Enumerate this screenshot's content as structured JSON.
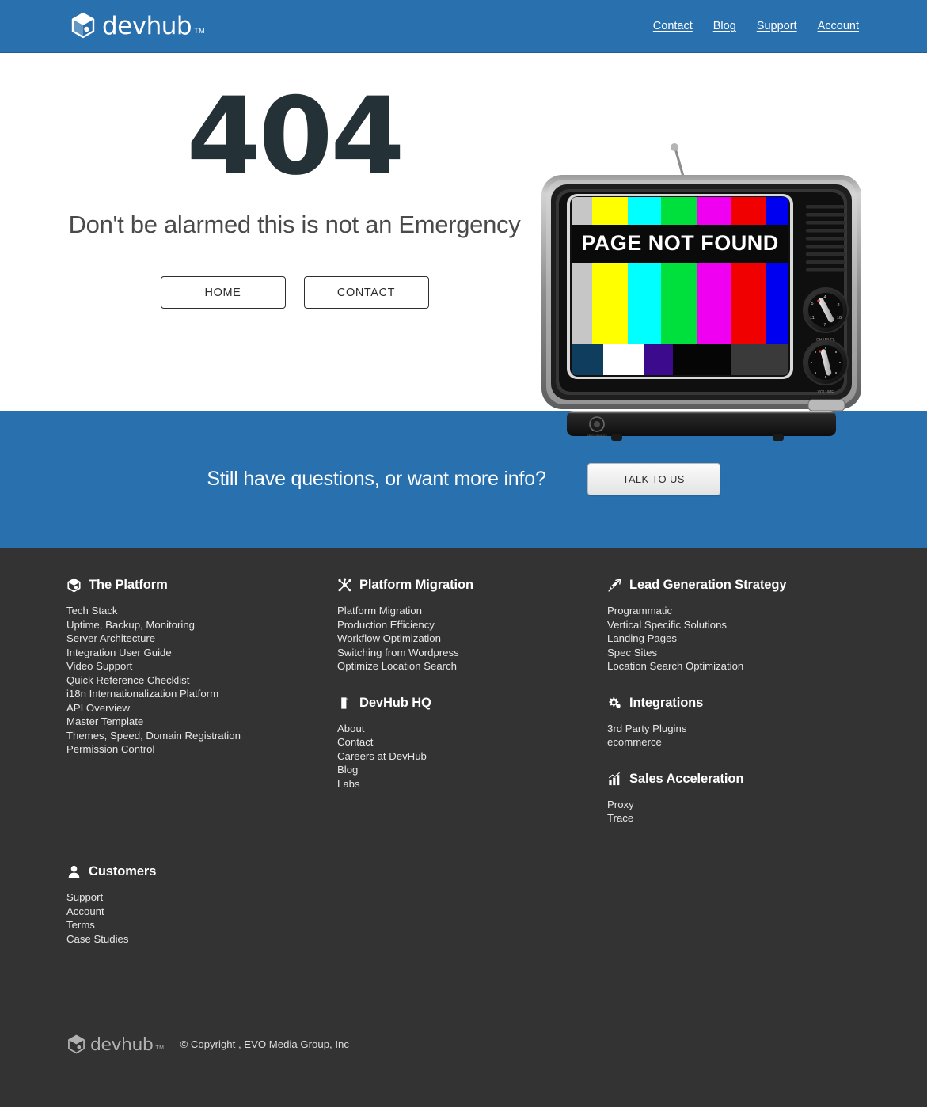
{
  "brand": {
    "name": "devhub",
    "tm": "TM",
    "header_bg": "#2870ae",
    "footer_bg": "#333333",
    "heading_color": "#243238"
  },
  "header": {
    "nav": [
      {
        "label": "Contact"
      },
      {
        "label": "Blog"
      },
      {
        "label": "Support"
      },
      {
        "label": "Account"
      }
    ]
  },
  "hero": {
    "code": "404",
    "subtitle": "Don't be alarmed this is not an Emergency",
    "buttons": [
      {
        "label": "HOME"
      },
      {
        "label": "CONTACT"
      }
    ],
    "tv": {
      "screen_message": "PAGE NOT FOUND",
      "knob_labels": [
        "CHANNEL",
        "VOLUME",
        "POWER"
      ],
      "base_label": "BRIGHTNESS",
      "color_bars": [
        "#c6c6c6",
        "#ffff00",
        "#00ffff",
        "#00e03c",
        "#f000f0",
        "#f00000",
        "#0000f0"
      ],
      "bottom_bars": [
        "#0e3d5e",
        "#ffffff",
        "#3c0a8c",
        "#050505",
        "#3a3a3a"
      ]
    }
  },
  "cta": {
    "text": "Still have questions, or want more info?",
    "button_label": "TALK TO US"
  },
  "footer": {
    "columns": [
      {
        "icon": "cube-icon",
        "title": "The Platform",
        "links": [
          "Tech Stack",
          "Uptime, Backup, Monitoring",
          "Server Architecture",
          "Integration User Guide",
          "Video Support",
          "Quick Reference Checklist",
          "i18n Internationalization Platform",
          "API Overview",
          "Master Template",
          "Themes, Speed, Domain Registration",
          "Permission Control"
        ]
      },
      {
        "icon": "sitemap-icon",
        "title": "Platform Migration",
        "links": [
          "Platform Migration",
          "Production Efficiency",
          "Workflow Optimization",
          "Switching from Wordpress",
          "Optimize Location Search"
        ]
      },
      {
        "icon": "building-icon",
        "title": "DevHub HQ",
        "links": [
          "About",
          "Contact",
          "Careers at DevHub",
          "Blog",
          "Labs"
        ]
      },
      {
        "icon": "rocket-icon",
        "title": "Lead Generation Strategy",
        "links": [
          "Programmatic",
          "Vertical Specific Solutions",
          "Landing Pages",
          "Spec Sites",
          "Location Search Optimization"
        ]
      },
      {
        "icon": "gears-icon",
        "title": "Integrations",
        "links": [
          "3rd Party Plugins",
          "ecommerce"
        ]
      },
      {
        "icon": "chart-icon",
        "title": "Sales Acceleration",
        "links": [
          "Proxy",
          "Trace"
        ]
      },
      {
        "icon": "user-icon",
        "title": "Customers",
        "links": [
          "Support",
          "Account",
          "Terms",
          "Case Studies"
        ]
      }
    ],
    "copyright": "© Copyright , EVO Media Group, Inc"
  }
}
